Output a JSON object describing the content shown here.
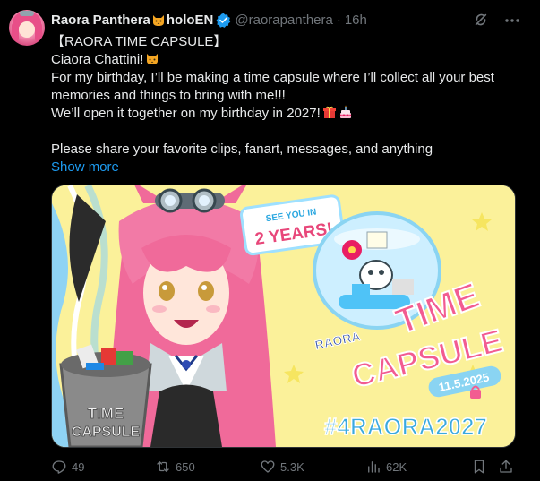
{
  "tweet": {
    "author_name": "Raora Panthera",
    "author_suffix": "holoEN",
    "handle": "@raorapanthera",
    "separator": "·",
    "time": "16h",
    "lines": [
      "【RAORA TIME CAPSULE】",
      "Ciaora Chattini!",
      "For my birthday, I’ll be making a time capsule where I’ll collect all your best",
      "memories and things to bring with me!!!",
      "We’ll open it together on my birthday in 2027!",
      "",
      "Please share your favorite clips, fanart, messages, and anything"
    ],
    "show_more": "Show more"
  },
  "media": {
    "sign_line1": "SEE YOU IN",
    "sign_line2": "2 YEARS!",
    "label_raora": "RAORA",
    "label_time": "TIME",
    "label_capsule": "CAPSULE",
    "date": "11.5.2025",
    "bin_line1": "TIME",
    "bin_line2": "CAPSULE",
    "hashtag": "#4RAORA2027"
  },
  "actions": {
    "replies": "49",
    "reposts": "650",
    "likes": "5.3K",
    "views": "62K"
  },
  "icons": {
    "cat": "cat-face-icon",
    "verified": "verified-badge-icon",
    "grok": "grok-icon",
    "more": "more-options-icon",
    "gift": "gift-icon",
    "cake": "birthday-cake-icon"
  },
  "colors": {
    "link": "#1d9bf0",
    "muted": "#71767b",
    "text": "#e7e9ea",
    "verified": "#1d9bf0"
  }
}
